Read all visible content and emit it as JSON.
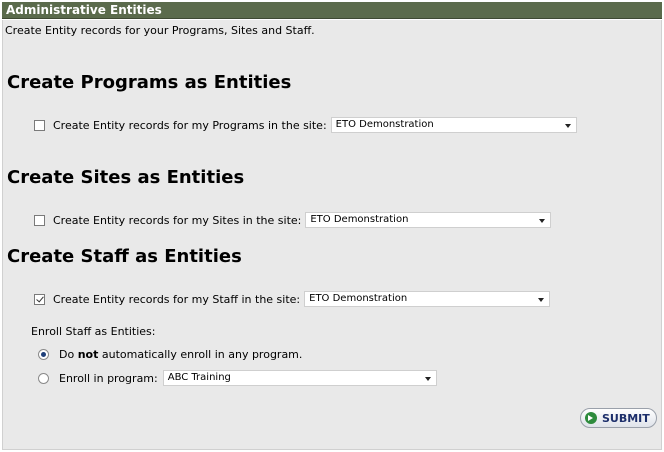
{
  "header": {
    "title": "Administrative Entities"
  },
  "intro": "Create Entity records for your Programs, Sites and Staff.",
  "programs": {
    "title": "Create Programs as Entities",
    "checkbox_label": "Create Entity records for my Programs in the site:",
    "checked": false,
    "site_select": "ETO Demonstration"
  },
  "sites": {
    "title": "Create Sites as Entities",
    "checkbox_label": "Create Entity records for my Sites in the site:",
    "checked": false,
    "site_select": "ETO Demonstration"
  },
  "staff": {
    "title": "Create Staff as Entities",
    "checkbox_label": "Create Entity records for my Staff in the site:",
    "checked": true,
    "site_select": "ETO Demonstration",
    "enroll_label": "Enroll Staff as Entities:",
    "option_no_pre": "Do ",
    "option_no_bold": "not",
    "option_no_post": " automatically enroll in any program.",
    "option_enroll": "Enroll in program:",
    "program_select": "ABC Training"
  },
  "submit_label": "SUBMIT"
}
